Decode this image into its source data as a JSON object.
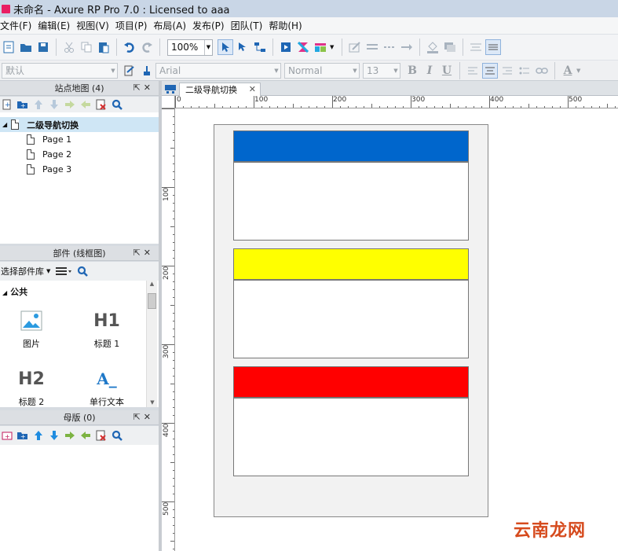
{
  "window": {
    "title": "未命名 - Axure RP Pro 7.0 : Licensed to aaa"
  },
  "menu": [
    "文件(F)",
    "编辑(E)",
    "视图(V)",
    "项目(P)",
    "布局(A)",
    "发布(P)",
    "团队(T)",
    "帮助(H)"
  ],
  "toolbar": {
    "zoom": "100%"
  },
  "format_bar": {
    "style": "默认",
    "font": "Arial",
    "weight": "Normal",
    "size": "13"
  },
  "sitemap": {
    "header": "站点地图 (4)",
    "pages": [
      {
        "label": "二级导航切换"
      },
      {
        "label": "Page 1"
      },
      {
        "label": "Page 2"
      },
      {
        "label": "Page 3"
      }
    ]
  },
  "widgets": {
    "header": "部件 (线框图)",
    "library_label": "选择部件库",
    "group": "公共",
    "items": [
      {
        "label": "图片",
        "icon": "image-icon"
      },
      {
        "label": "标题 1",
        "glyph": "H1"
      },
      {
        "label": "标题 2",
        "glyph": "H2"
      },
      {
        "label": "单行文本",
        "glyph": "A_"
      }
    ]
  },
  "masters": {
    "header": "母版 (0)"
  },
  "editor": {
    "tab_label": "二级导航切换",
    "ruler_h": [
      "0",
      "100",
      "200",
      "300",
      "400",
      "500"
    ],
    "ruler_v": [
      "100",
      "200",
      "300",
      "400",
      "500"
    ],
    "nav_colors": [
      "#0066cc",
      "#ffff00",
      "#ff0000"
    ]
  },
  "watermark": "云南龙网"
}
